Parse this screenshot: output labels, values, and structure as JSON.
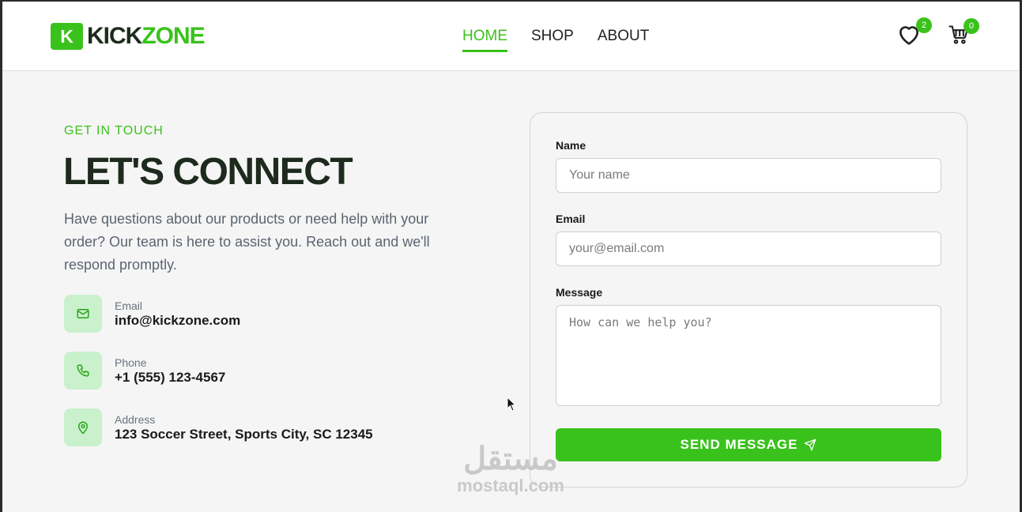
{
  "brand": {
    "badge": "K",
    "name_part1": "KICK",
    "name_part2": "ZONE",
    "accent": "#3ac21c"
  },
  "nav": {
    "items": [
      "HOME",
      "SHOP",
      "ABOUT"
    ],
    "active": "HOME"
  },
  "header_icons": {
    "wishlist_count": "2",
    "cart_count": "0",
    "wishlist_icon": "heart-icon",
    "cart_icon": "cart-icon"
  },
  "contact": {
    "eyebrow": "GET IN TOUCH",
    "heading": "LET'S CONNECT",
    "description": "Have questions about our products or need help with your order? Our team is here to assist you. Reach out and we'll respond promptly.",
    "items": [
      {
        "icon": "mail-icon",
        "label": "Email",
        "value": "info@kickzone.com"
      },
      {
        "icon": "phone-icon",
        "label": "Phone",
        "value": "+1 (555) 123-4567"
      },
      {
        "icon": "map-pin-icon",
        "label": "Address",
        "value": "123 Soccer Street, Sports City, SC 12345"
      }
    ]
  },
  "form": {
    "name_label": "Name",
    "name_placeholder": "Your name",
    "email_label": "Email",
    "email_placeholder": "your@email.com",
    "message_label": "Message",
    "message_placeholder": "How can we help you?",
    "submit_label": "SEND MESSAGE"
  },
  "watermark": {
    "arabic": "مستقل",
    "latin": "mostaql.com"
  }
}
